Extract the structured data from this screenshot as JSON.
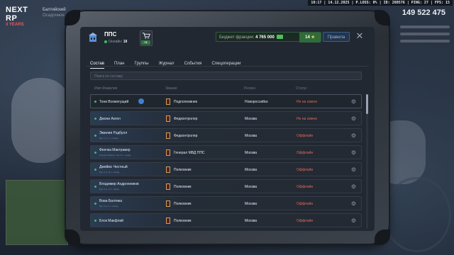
{
  "hud": {
    "logo_line1": "NEXT RP",
    "logo_line2": "3 YEARS",
    "location": "Балтийский",
    "location_sub": "Осадочное",
    "top_status": "10:17 | 14.12.2025 | P.LOSS: 0% | ID: 280576 | PING: 27 | FPS: 15",
    "money": "149 522 475"
  },
  "header": {
    "faction_name": "ППС",
    "online_label": "Онлайн:",
    "online_count": "18",
    "shop_badge": "+1",
    "budget_label": "Бюджет фракции:",
    "budget_value": "4 765 000",
    "stars": "14",
    "rules_label": "Правила",
    "close_symbol": "✕"
  },
  "tabs": [
    {
      "label": "Состав",
      "active": true
    },
    {
      "label": "План",
      "active": false
    },
    {
      "label": "Группы",
      "active": false
    },
    {
      "label": "Журнал",
      "active": false
    },
    {
      "label": "События",
      "active": false
    },
    {
      "label": "Спецоперации",
      "active": false
    }
  ],
  "search": {
    "placeholder": "Поиск по составу"
  },
  "columns": {
    "name": "Имя Фамилия",
    "rank": "Звание",
    "city": "Регион",
    "status": "Статус"
  },
  "members": [
    {
      "name": "Тони Всемогущий",
      "sub": "",
      "rank": "Подполковник",
      "city": "Новороссийск",
      "status": "Не на смене",
      "verified": true
    },
    {
      "name": "Джони Ангел",
      "sub": "",
      "rank": "Федконтролер",
      "city": "Москва",
      "status": "Не на смене",
      "verified": false
    },
    {
      "name": "Эмилия Рэдбулл",
      "sub": "Был 7 д. 4 ч. назад",
      "rank": "Федконтролер",
      "city": "Москва",
      "status": "Оффлайн",
      "verified": false
    },
    {
      "name": "Феечка Мактравер",
      "sub": "Лоньки Жмаксы: был 9 ч. назад",
      "rank": "Генерал МВД ППС",
      "city": "Москва",
      "status": "Оффлайн",
      "verified": false
    },
    {
      "name": "Джеймс Честный",
      "sub": "Был 1 д. 16 ч. назад",
      "rank": "Полковник",
      "city": "Москва",
      "status": "Оффлайн",
      "verified": false
    },
    {
      "name": "Владимир Андронников",
      "sub": "Был 4 д. 11 ч. назад",
      "rank": "Полковник",
      "city": "Москва",
      "status": "Оффлайн",
      "verified": false
    },
    {
      "name": "Вова Балтика",
      "sub": "Был 1 д. 6 ч. назад",
      "rank": "Полковник",
      "city": "Москва",
      "status": "Оффлайн",
      "verified": false
    },
    {
      "name": "Блэк Макфлай",
      "sub": "",
      "rank": "Полковник",
      "city": "Москва",
      "status": "Оффлайн",
      "verified": false
    }
  ],
  "colors": {
    "accent_green": "#38c15a",
    "status_red": "#e46a5a",
    "rules_blue": "#8fb6e6"
  },
  "icons": {
    "faction": "police-building-icon",
    "shop": "cart-icon",
    "cash": "cash-icon",
    "star": "star-icon",
    "settings": "gear-icon",
    "verified": "verified-user-icon",
    "rank": "rank-insignia-icon"
  }
}
